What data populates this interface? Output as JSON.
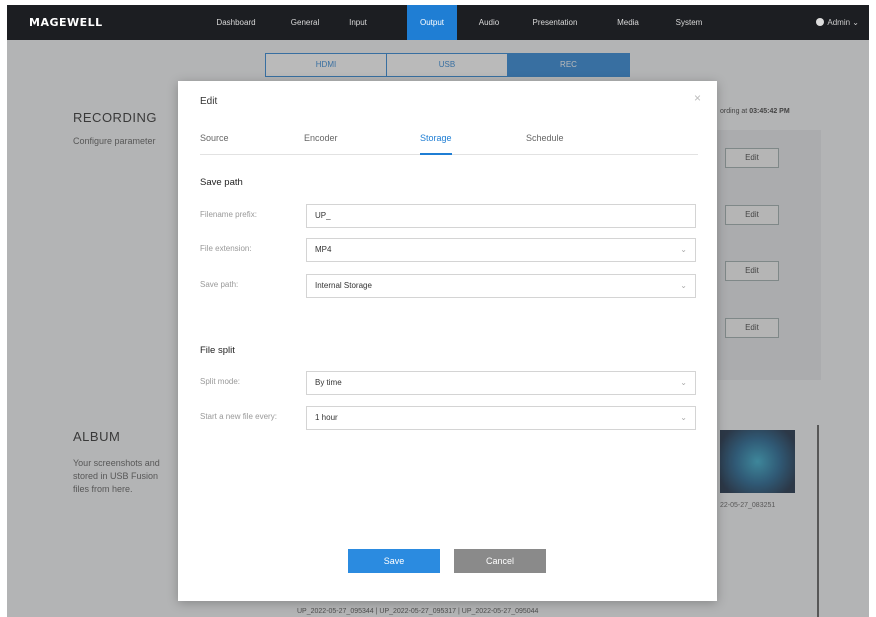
{
  "topbar": {
    "logo": "MAGEWELL",
    "nav": [
      "Dashboard",
      "General",
      "Input",
      "Output",
      "Audio",
      "Presentation",
      "Media",
      "System"
    ],
    "active_nav": "Output",
    "user": "Admin ⌄"
  },
  "subtabs": [
    "HDMI",
    "USB",
    "REC"
  ],
  "page": {
    "recording_title": "RECORDING",
    "recording_desc": "Configure parameter",
    "recording_time_prefix": "ording at",
    "recording_time_value": "03:45:42 PM",
    "edit_label": "Edit",
    "album_title": "ALBUM",
    "album_desc": [
      "Your screenshots and",
      "stored in USB Fusion",
      "files from here."
    ],
    "album_thumb_caption": "22-05-27_083251",
    "bottom_captions": "UP_2022-05-27_095344  |  UP_2022-05-27_095317  |  UP_2022-05-27_095044"
  },
  "modal": {
    "title": "Edit",
    "close": "×",
    "tabs": [
      "Source",
      "Encoder",
      "Storage",
      "Schedule"
    ],
    "active_tab": "Storage",
    "save_path_title": "Save path",
    "filename_prefix_label": "Filename prefix:",
    "filename_prefix_value": "UP_",
    "file_extension_label": "File extension:",
    "file_extension_value": "MP4",
    "save_path_label": "Save path:",
    "save_path_value": "Internal Storage",
    "file_split_title": "File split",
    "split_mode_label": "Split mode:",
    "split_mode_value": "By time",
    "new_file_label": "Start a new file every:",
    "new_file_value": "1 hour",
    "save_label": "Save",
    "cancel_label": "Cancel"
  },
  "colors": {
    "accent": "#1f7ed4",
    "topbar": "#1c1e22",
    "cancel": "#8a8a8a"
  }
}
